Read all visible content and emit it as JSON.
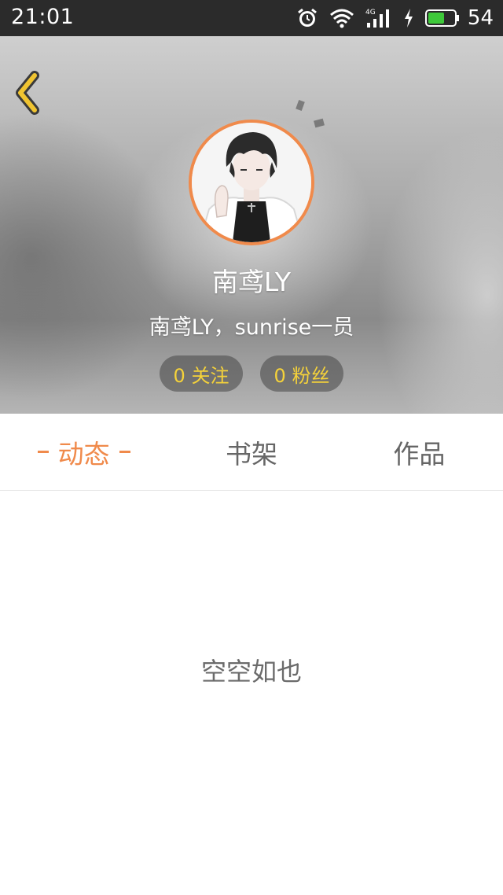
{
  "status_bar": {
    "time": "21:01",
    "network": "4G",
    "battery": "54",
    "icons": [
      "alarm-icon",
      "wifi-icon",
      "signal-icon",
      "charging-icon",
      "battery-icon"
    ]
  },
  "header": {
    "back_icon": "chevron-left-icon",
    "username": "南鸢LY",
    "bio": "南鸢LY，sunrise一员",
    "follow_label": "0 关注",
    "fans_label": "0 粉丝"
  },
  "tabs": [
    {
      "label": "动态",
      "active": true
    },
    {
      "label": "书架",
      "active": false
    },
    {
      "label": "作品",
      "active": false
    }
  ],
  "content": {
    "empty_message": "空空如也"
  },
  "colors": {
    "accent": "#f08a4b",
    "stat_text": "#f5d23a",
    "back_icon": "#f0c431",
    "status_bar": "#2b2b2b"
  }
}
